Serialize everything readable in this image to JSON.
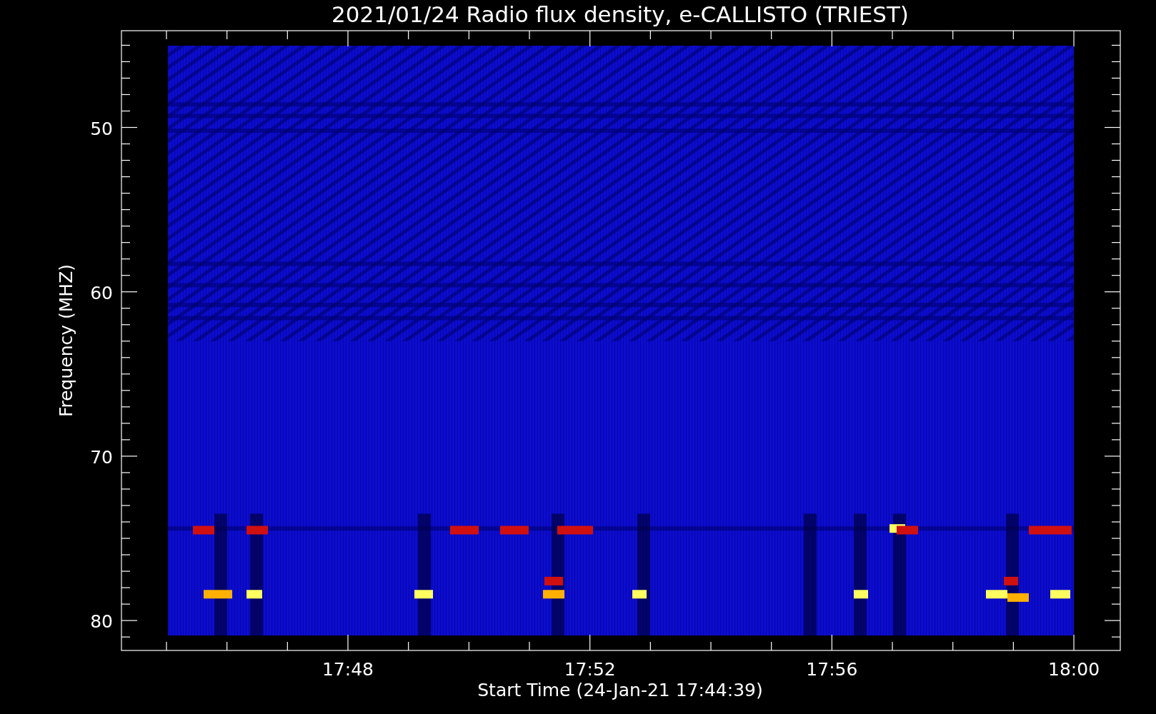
{
  "title": "2021/01/24  Radio flux density, e-CALLISTO (TRIEST)",
  "x_axis": {
    "label": "Start Time (24-Jan-21 17:44:39)",
    "ticks": [
      "17:48",
      "17:52",
      "17:56",
      "18:00"
    ]
  },
  "y_axis": {
    "label": "Frequency (MHZ)",
    "ticks": [
      "50",
      "60",
      "70",
      "80"
    ]
  }
}
